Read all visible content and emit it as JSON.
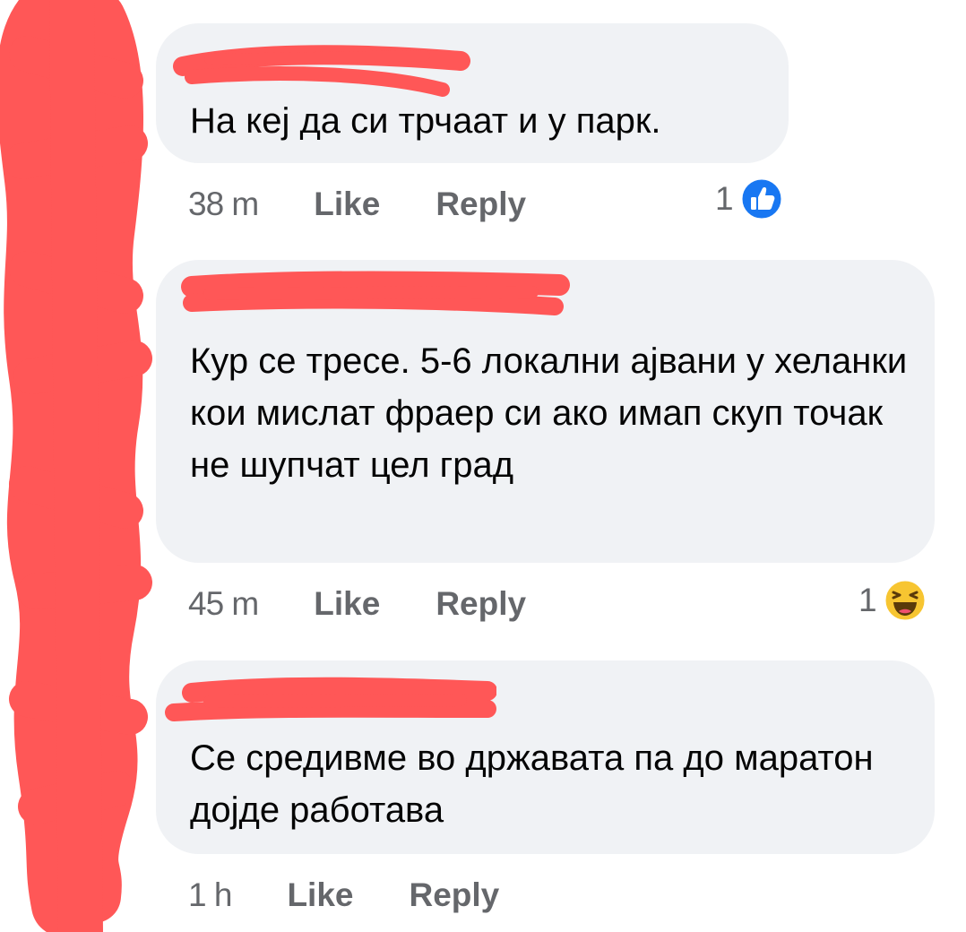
{
  "comments": [
    {
      "text": "На кеј да си трчаат и у парк.",
      "time": "38 m",
      "like_label": "Like",
      "reply_label": "Reply",
      "reaction_count": "1",
      "reaction_icon": "like-icon"
    },
    {
      "text": "Кур се тресе. 5-6 локални ајвани у хеланки кои мислат фраер си ако имап скуп точак не шупчат цел град",
      "time": "45 m",
      "like_label": "Like",
      "reply_label": "Reply",
      "reaction_count": "1",
      "reaction_icon": "haha-icon"
    },
    {
      "text": "Се средивме во државата па до маратон дојде работава",
      "time": "1 h",
      "like_label": "Like",
      "reply_label": "Reply"
    }
  ],
  "colors": {
    "redaction": "#ff5757",
    "bubble": "#f0f2f5",
    "meta_text": "#65676b",
    "like_blue": "#1877f2",
    "haha_yellow": "#f7c531"
  }
}
